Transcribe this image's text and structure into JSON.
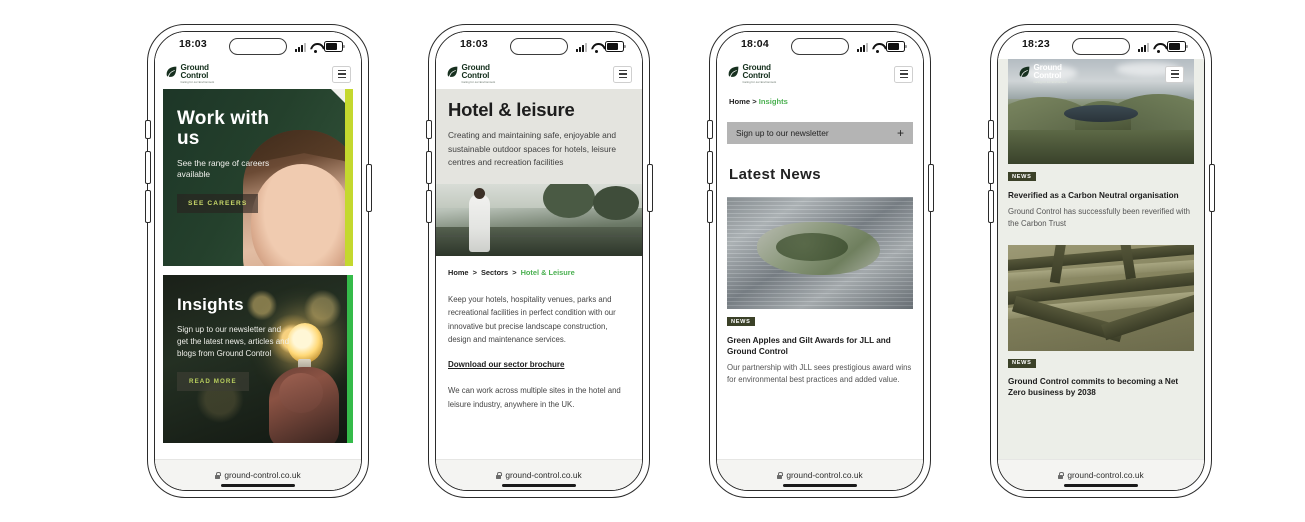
{
  "brand": {
    "name_line1": "Ground",
    "name_line2": "Control",
    "tagline": "Caring for our Environment",
    "accent_lime": "#c4d82e",
    "accent_green": "#35bb4a",
    "dark_green": "#1d3627",
    "badge_bg": "#3b4128"
  },
  "url_bar": {
    "url": "ground-control.co.uk",
    "lock_icon": "lock-icon"
  },
  "phones": [
    {
      "id": "phone-1",
      "status": {
        "time": "18:03",
        "signal_icon": "signal-bars-icon",
        "wifi_icon": "wifi-icon",
        "battery_icon": "battery-icon"
      },
      "header": {
        "menu_icon": "hamburger-menu-icon"
      },
      "cards": [
        {
          "title": "Work with us",
          "subtitle": "See the range of careers available",
          "button": "SEE CAREERS",
          "image_alt": "smiling-woman-photo"
        },
        {
          "title": "Insights",
          "subtitle": "Sign up to our newsletter and get the latest news, articles and blogs from Ground Control",
          "button": "READ MORE",
          "image_alt": "hand-holding-lightbulb-photo"
        }
      ]
    },
    {
      "id": "phone-2",
      "status": {
        "time": "18:03"
      },
      "header": {
        "menu_icon": "hamburger-menu-icon"
      },
      "page_title": "Hotel & leisure",
      "page_intro": "Creating and maintaining safe, enjoyable and sustainable outdoor spaces for hotels, leisure centres and recreation facilities",
      "hero_image_alt": "person-walking-on-bridge-photo",
      "breadcrumb": {
        "home": "Home",
        "sep": ">",
        "sectors": "Sectors",
        "current": "Hotel & Leisure"
      },
      "body_1": "Keep your hotels, hospitality venues, parks and recreational facilities in perfect condition with our innovative but precise landscape construction, design and maintenance services.",
      "brochure_link": "Download our sector brochure",
      "body_2": "We can work across multiple sites in the hotel and leisure industry, anywhere in the UK."
    },
    {
      "id": "phone-3",
      "status": {
        "time": "18:04"
      },
      "header": {
        "menu_icon": "hamburger-menu-icon"
      },
      "breadcrumb": {
        "home": "Home",
        "sep": ">",
        "current": "Insights"
      },
      "newsletter": {
        "label": "Sign up to our newsletter",
        "expand_icon": "plus-icon"
      },
      "section_title": "Latest News",
      "article": {
        "image_alt": "aerial-rooftop-garden-photo",
        "badge": "NEWS",
        "title": "Green Apples and Gilt Awards for JLL and Ground Control",
        "description": "Our partnership with JLL sees prestigious award wins for environmental best practices and added value."
      }
    },
    {
      "id": "phone-4",
      "status": {
        "time": "18:23"
      },
      "header": {
        "menu_icon": "hamburger-menu-icon"
      },
      "articles": [
        {
          "image_alt": "mountain-lake-landscape-photo",
          "badge": "NEWS",
          "title": "Reverified as a Carbon Neutral organisation",
          "description": "Ground Control has successfully been reverified with the Carbon Trust"
        },
        {
          "image_alt": "hedge-maze-photo",
          "badge": "NEWS",
          "title": "Ground Control commits to becoming a Net Zero business by 2038",
          "description": ""
        }
      ]
    }
  ]
}
